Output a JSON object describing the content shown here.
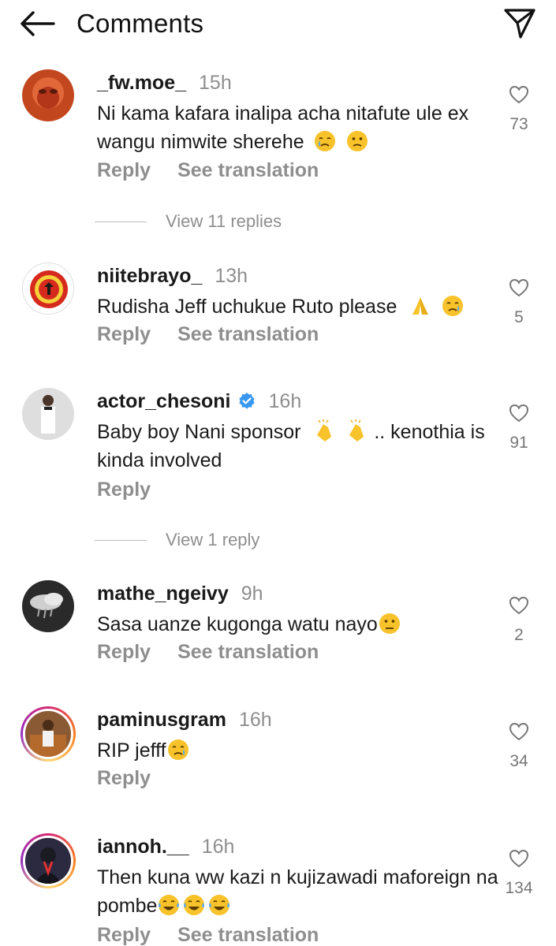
{
  "header": {
    "title": "Comments"
  },
  "actions": {
    "reply": "Reply",
    "translate": "See translation"
  },
  "comments": [
    {
      "username": "_fw.moe_",
      "time": "15h",
      "text": "Ni kama kafara inalipa acha nitafute ule ex wangu nimwite sherehe",
      "likes": "73",
      "verified": false,
      "translation": true,
      "emojis": [
        "crying-face",
        "confused-face"
      ],
      "replies_label": "View 11 replies"
    },
    {
      "username": "niitebrayo_",
      "time": "13h",
      "text": "Rudisha Jeff uchukue Ruto please",
      "likes": "5",
      "verified": false,
      "translation": true,
      "emojis": [
        "folded-hands",
        "crying-face"
      ]
    },
    {
      "username": "actor_chesoni",
      "time": "16h",
      "text": "Baby boy Nani sponsor",
      "text2": ".. kenothia is kinda involved",
      "likes": "91",
      "verified": true,
      "translation": false,
      "emojis": [
        "clapping-hands",
        "clapping-hands"
      ],
      "replies_label": "View 1 reply"
    },
    {
      "username": "mathe_ngeivy",
      "time": "9h",
      "text": "Sasa uanze kugonga watu nayo",
      "likes": "2",
      "verified": false,
      "translation": true,
      "emojis": [
        "confused-face"
      ]
    },
    {
      "username": "paminusgram",
      "time": "16h",
      "text": "RIP jefff",
      "likes": "34",
      "verified": false,
      "translation": false,
      "emojis": [
        "crying-face"
      ]
    },
    {
      "username": "iannoh.__",
      "time": "16h",
      "text": "Then kuna ww kazi n kujizawadi maforeign na pombe",
      "likes": "134",
      "verified": false,
      "translation": true,
      "emojis": [
        "tears-of-joy-face",
        "tears-of-joy-face",
        "tears-of-joy-face"
      ]
    }
  ],
  "colors": {
    "muted": "#8e8e8e",
    "text": "#1a1a1a",
    "verified": "#3897f0",
    "emoji": "#f7c22a"
  }
}
